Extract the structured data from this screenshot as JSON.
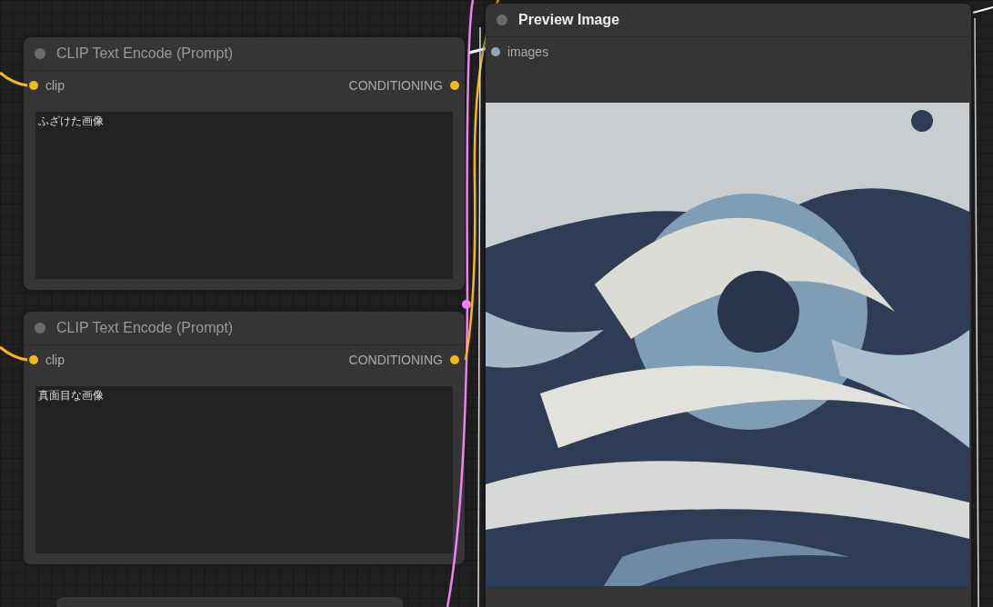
{
  "nodes": [
    {
      "kind": "text_encode",
      "title": "CLIP Text Encode (Prompt)",
      "inputs": [
        {
          "label": "clip",
          "color": "#f5b818"
        }
      ],
      "outputs": [
        {
          "label": "CONDITIONING",
          "color": "#f5b818"
        }
      ],
      "text": "ふざけた画像"
    },
    {
      "kind": "text_encode",
      "title": "CLIP Text Encode (Prompt)",
      "inputs": [
        {
          "label": "clip",
          "color": "#f5b818"
        }
      ],
      "outputs": [
        {
          "label": "CONDITIONING",
          "color": "#f5b818"
        }
      ],
      "text": "真面目な画像"
    },
    {
      "kind": "preview",
      "title": "Preview Image",
      "inputs": [
        {
          "label": "images",
          "color": "#8fa8b8"
        }
      ]
    }
  ]
}
